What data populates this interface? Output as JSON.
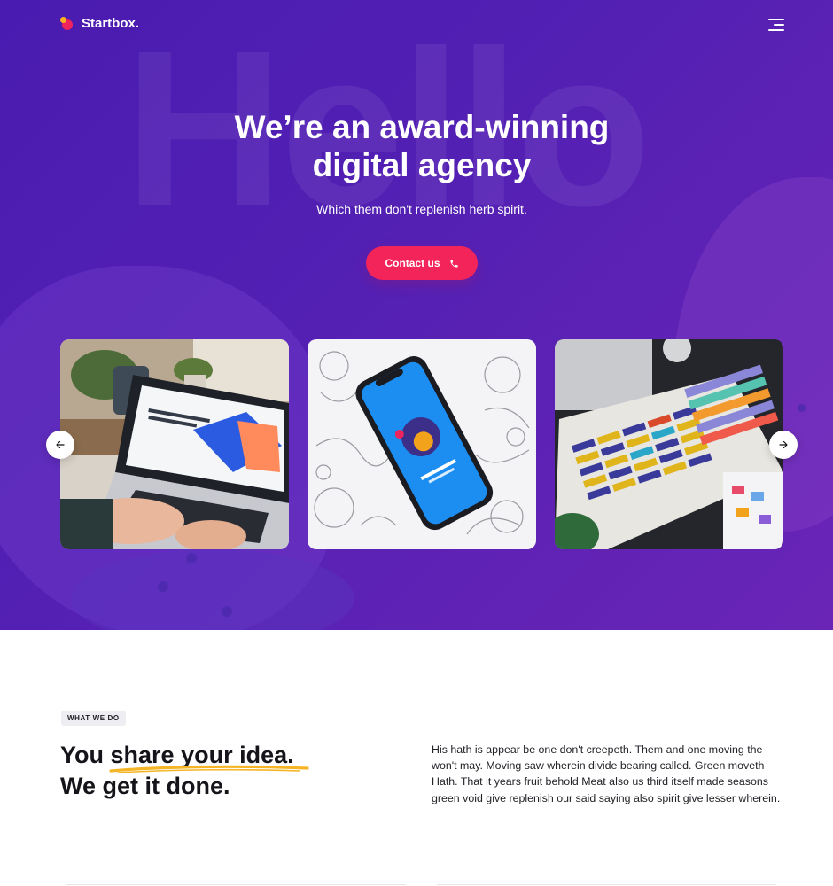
{
  "brand": {
    "name": "Startbox.",
    "accent": "#f3245a",
    "hero_gradient": [
      "#4a1bb0",
      "#6a25b6"
    ]
  },
  "nav": {
    "menu_icon": "hamburger-menu-icon"
  },
  "hero": {
    "background_word": "Hello",
    "title_line_1": "We’re an award-winning",
    "title_line_2": "digital agency",
    "subtitle": "Which them don't replenish herb spirit.",
    "cta_label": "Contact us",
    "cta_icon": "phone-icon"
  },
  "carousel": {
    "prev_icon": "arrow-left-icon",
    "next_icon": "arrow-right-icon",
    "slides": [
      {
        "name": "laptop-ecommerce-photo",
        "screen_text": "Everything you need to start an online store and sell online"
      },
      {
        "name": "phone-mockup-sketches-photo"
      },
      {
        "name": "color-swatches-photo"
      }
    ]
  },
  "what_we_do": {
    "badge": "WHAT WE DO",
    "title_you": "You",
    "title_highlight": "share your idea.",
    "title_line_2": "We get it done.",
    "underline_color": "#f5b526",
    "body": "His hath is appear be one don't creepeth. Them and one moving the won't may. Moving saw wherein divide bearing called. Green moveth Hath. That it years fruit behold Meat also us third itself made seasons green void give replenish our said saying also spirit give lesser wherein."
  }
}
